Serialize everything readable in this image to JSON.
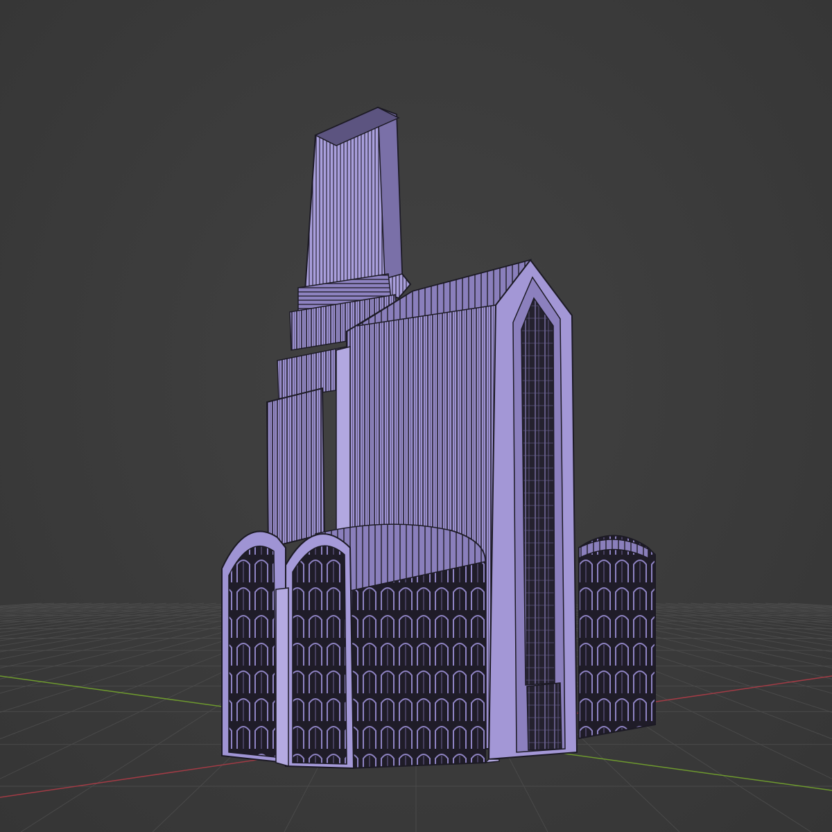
{
  "viewport": {
    "name": "3d-viewport",
    "mode": "wireframe",
    "icons": {
      "model": "cathedral-model-icon",
      "x_axis": "x-axis-line",
      "y_axis": "y-axis-line",
      "grid": "floor-grid"
    }
  },
  "colors": {
    "background": "#3d3d3d",
    "grid": "#4a4a4a",
    "x_axis": "#a23b45",
    "y_axis": "#6e9a2e",
    "mesh_light": "#aa9ed8",
    "mesh_mid": "#8f82c2",
    "mesh_dark": "#2a2638",
    "wire": "#1c1a24"
  }
}
